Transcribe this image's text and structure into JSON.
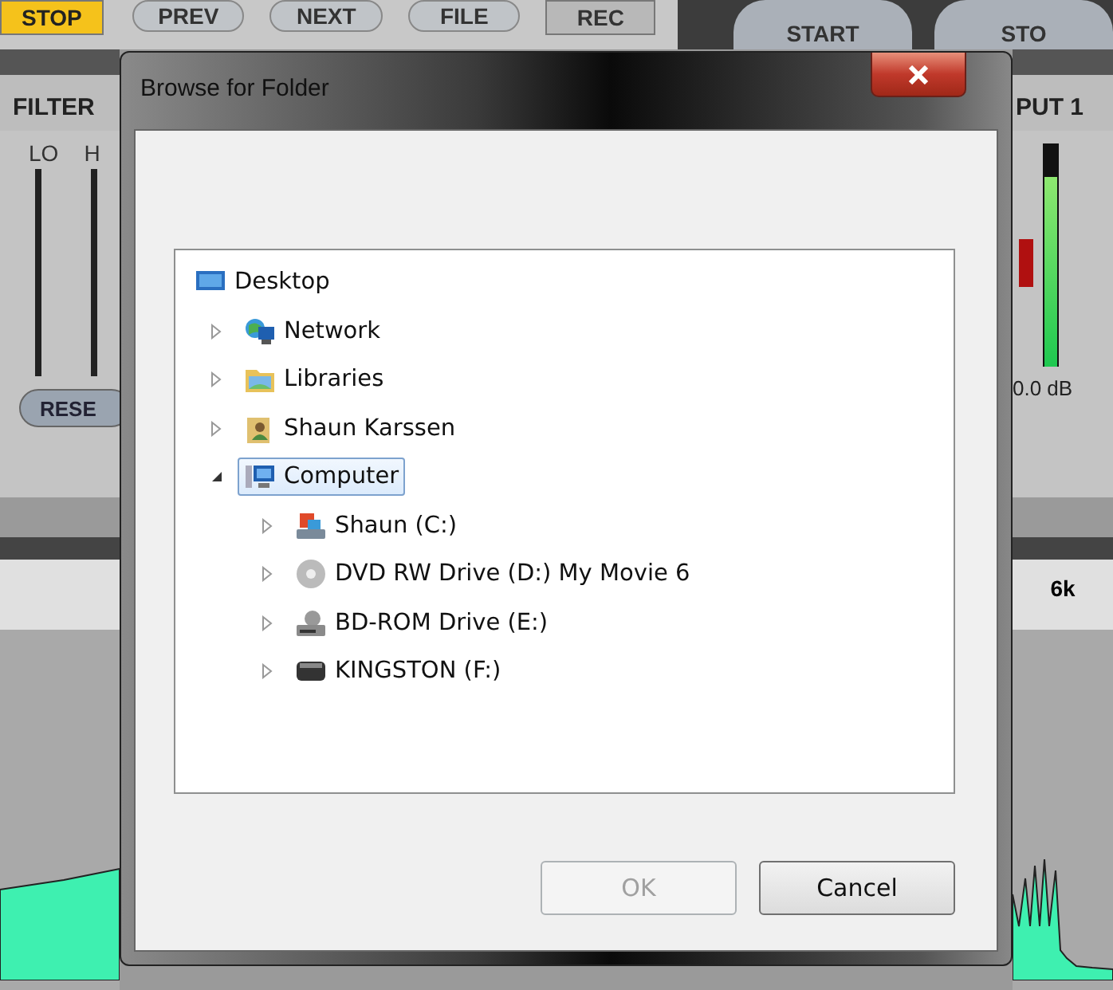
{
  "toolbar": [
    {
      "label": "STOP",
      "kind": "square",
      "lit": true
    },
    {
      "label": "PREV",
      "kind": "pill",
      "lit": false
    },
    {
      "label": "NEXT",
      "kind": "pill",
      "lit": false
    },
    {
      "label": "FILE",
      "kind": "pill",
      "lit": false
    },
    {
      "label": "REC",
      "kind": "square",
      "lit": false
    },
    {
      "label": "START",
      "kind": "round",
      "lit": false
    },
    {
      "label": "STO",
      "kind": "round",
      "lit": false
    }
  ],
  "left_panel": {
    "title": "FILTER",
    "sliders": [
      "LO",
      "H"
    ],
    "reset_button": "RESE"
  },
  "right_panel": {
    "title": "PUT 1",
    "meter": {
      "level": 0.85,
      "reading": "0.0 dB"
    },
    "clip": true,
    "frequency_label": "6k"
  },
  "dialog": {
    "title": "Browse for Folder",
    "tree": [
      {
        "label": "Desktop",
        "kind": "desktop",
        "selected": false,
        "children": [
          {
            "label": "Network",
            "kind": "network",
            "selected": false,
            "expanded": false
          },
          {
            "label": "Libraries",
            "kind": "libraries",
            "selected": false,
            "expanded": false
          },
          {
            "label": "Shaun Karssen",
            "kind": "user",
            "selected": false,
            "expanded": false
          },
          {
            "label": "Computer",
            "kind": "computer",
            "selected": true,
            "expanded": true,
            "children": [
              {
                "label": "Shaun (C:)",
                "kind": "system-drive",
                "selected": false,
                "expanded": false
              },
              {
                "label": "DVD RW Drive (D:) My Movie 6",
                "kind": "disc",
                "selected": false,
                "expanded": false
              },
              {
                "label": "BD-ROM Drive (E:)",
                "kind": "optical-drive",
                "selected": false,
                "expanded": false
              },
              {
                "label": "KINGSTON (F:)",
                "kind": "usb",
                "selected": false,
                "expanded": false
              }
            ]
          }
        ]
      }
    ],
    "buttons": [
      {
        "label": "OK",
        "disabled": true
      },
      {
        "label": "Cancel",
        "disabled": false
      }
    ]
  }
}
